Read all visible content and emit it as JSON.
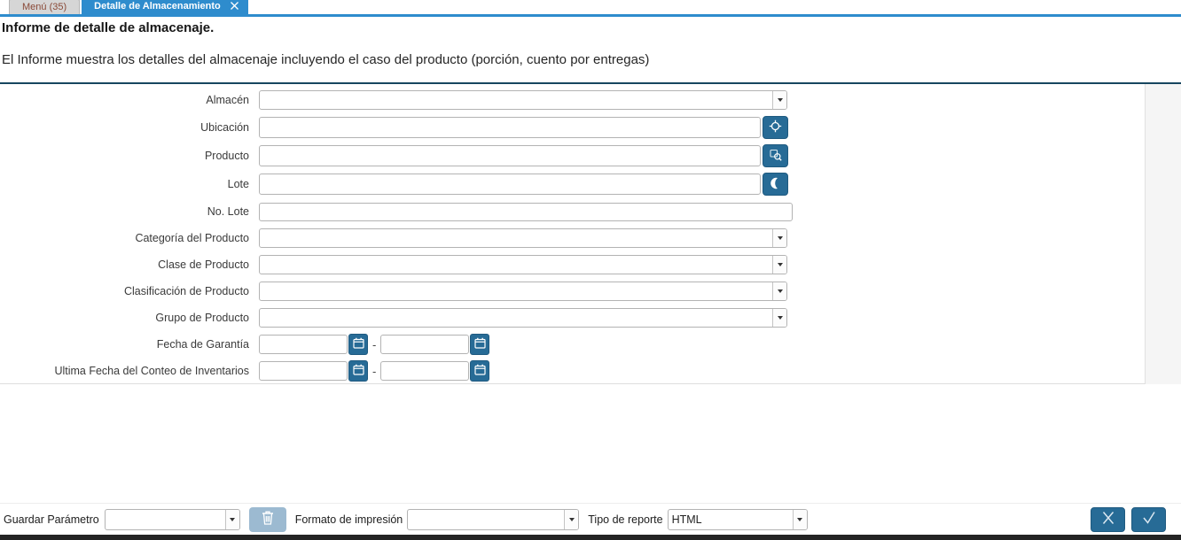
{
  "tabs": {
    "menu_label": "Menú (35)",
    "active_label": "Detalle de Almacenamiento"
  },
  "header": {
    "title": "Informe de detalle de almacenaje.",
    "description": "El Informe muestra los detalles del almacenaje incluyendo el caso del producto (porción, cuento por entregas)"
  },
  "form": {
    "date_separator": "-",
    "fields": [
      {
        "label": "Almacén",
        "type": "combo",
        "value": ""
      },
      {
        "label": "Ubicación",
        "type": "search",
        "value": ""
      },
      {
        "label": "Producto",
        "type": "search",
        "value": ""
      },
      {
        "label": "Lote",
        "type": "search",
        "value": ""
      },
      {
        "label": "No. Lote",
        "type": "text",
        "value": ""
      },
      {
        "label": "Categoría del Producto",
        "type": "combo",
        "value": ""
      },
      {
        "label": "Clase de Producto",
        "type": "combo",
        "value": ""
      },
      {
        "label": "Clasificación de Producto",
        "type": "combo",
        "value": ""
      },
      {
        "label": "Grupo de Producto",
        "type": "combo",
        "value": ""
      },
      {
        "label": "Fecha de Garantía",
        "type": "daterange",
        "value_from": "",
        "value_to": ""
      },
      {
        "label": "Ultima Fecha del Conteo de Inventarios",
        "type": "daterange",
        "value_from": "",
        "value_to": ""
      }
    ]
  },
  "footer": {
    "save_parameter_label": "Guardar Parámetro",
    "save_parameter_value": "",
    "print_format_label": "Formato de impresión",
    "print_format_value": "",
    "report_type_label": "Tipo de reporte",
    "report_type_value": "HTML"
  },
  "colors": {
    "accent_blue": "#2e8ccd",
    "button_blue": "#276b96",
    "disabled_button_blue": "#9cbad1",
    "divider_navy": "#17465f",
    "inactive_tab_text": "#8a4a38",
    "bottom_bar": "#242424"
  }
}
